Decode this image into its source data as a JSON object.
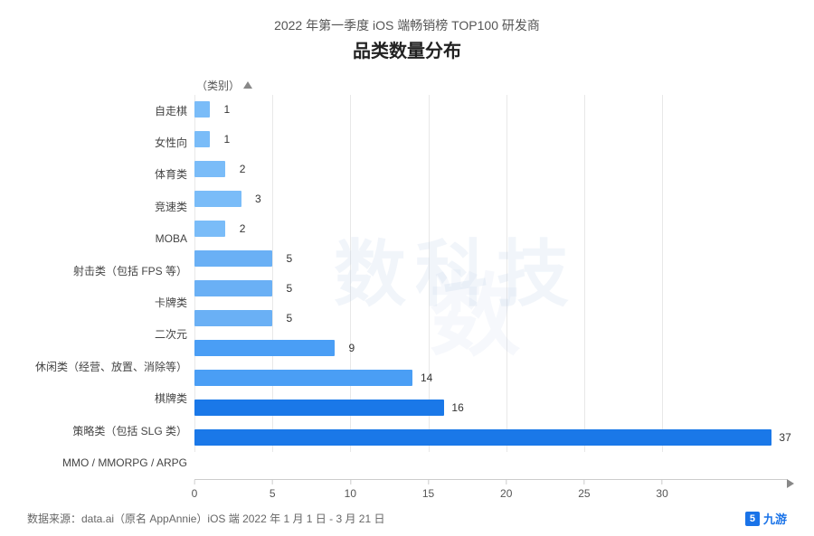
{
  "title": {
    "subtitle": "2022 年第一季度 iOS 端畅销榜 TOP100 研发商",
    "main": "品类数量分布"
  },
  "yAxisLabel": "（类别）",
  "categories": [
    {
      "label": "自走棋",
      "value": 1
    },
    {
      "label": "女性向",
      "value": 1
    },
    {
      "label": "体育类",
      "value": 2
    },
    {
      "label": "竞速类",
      "value": 3
    },
    {
      "label": "MOBA",
      "value": 2
    },
    {
      "label": "射击类（包括 FPS 等）",
      "value": 5
    },
    {
      "label": "卡牌类",
      "value": 5
    },
    {
      "label": "二次元",
      "value": 5
    },
    {
      "label": "休闲类（经营、放置、消除等）",
      "value": 9
    },
    {
      "label": "棋牌类",
      "value": 14
    },
    {
      "label": "策略类（包括 SLG 类）",
      "value": 16
    },
    {
      "label": "MMO / MMORPG / ARPG",
      "value": 37
    }
  ],
  "xTicks": [
    0,
    5,
    10,
    15,
    20,
    25,
    30
  ],
  "maxValue": 37,
  "footer": {
    "source": "数据来源：data.ai（原名 AppAnnie）iOS 端 2022 年 1 月 1 日 - 3 月 21 日",
    "logoNum": "5",
    "logoText": "九游"
  },
  "barColor": {
    "normal": "#5ba3f5",
    "dark": "#2196f3"
  }
}
